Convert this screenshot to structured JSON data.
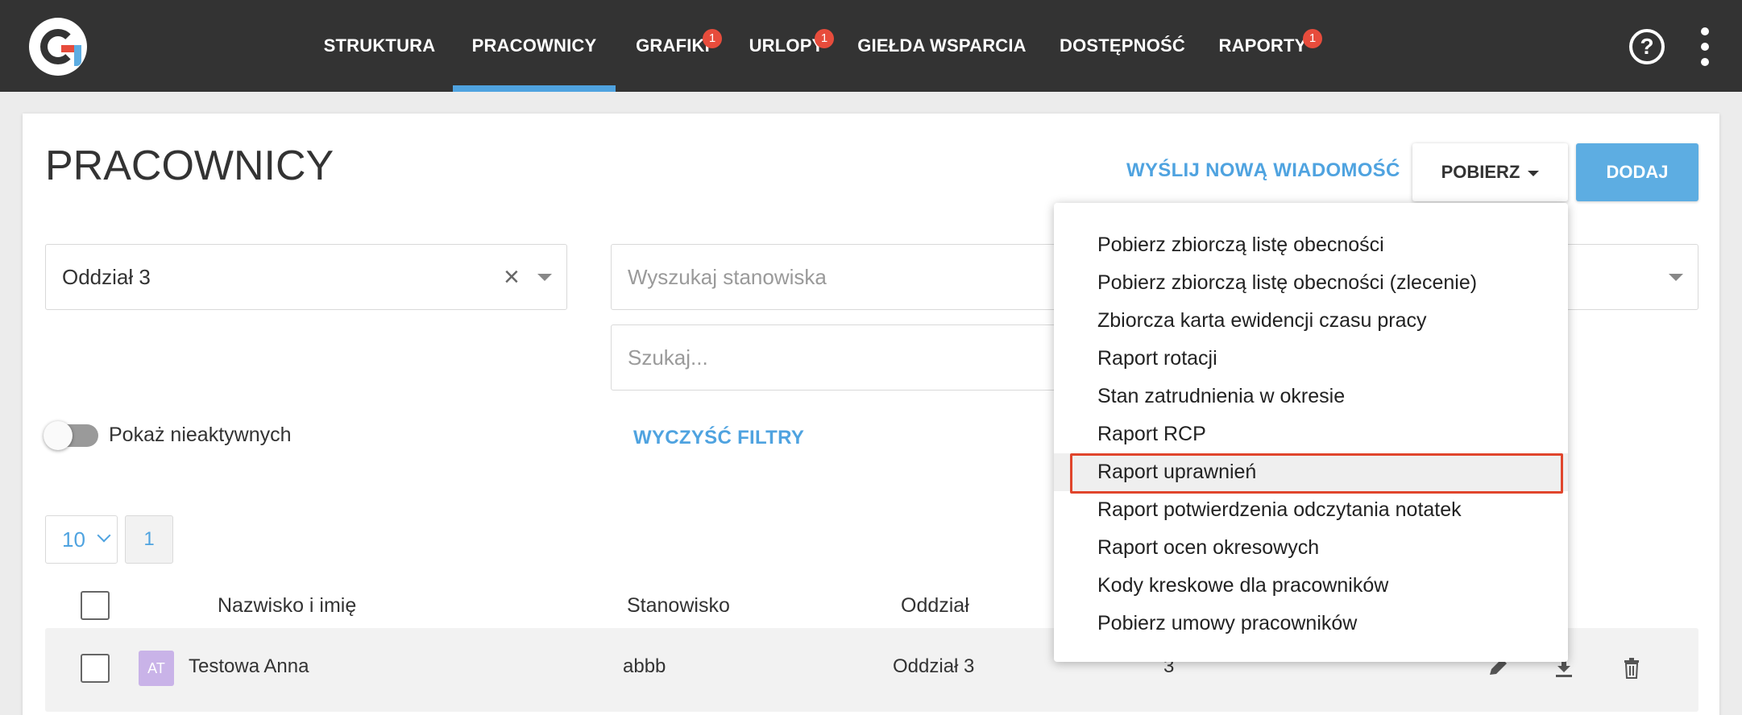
{
  "nav": {
    "items": [
      {
        "label": "STRUKTURA",
        "badge": ""
      },
      {
        "label": "PRACOWNICY",
        "badge": ""
      },
      {
        "label": "GRAFIKI",
        "badge": "1"
      },
      {
        "label": "URLOPY",
        "badge": "1"
      },
      {
        "label": "GIEŁDA WSPARCIA",
        "badge": ""
      },
      {
        "label": "DOSTĘPNOŚĆ",
        "badge": ""
      },
      {
        "label": "RAPORTY",
        "badge": "1"
      }
    ],
    "active_index": 1,
    "help_glyph": "?",
    "accent_color": "#4fa3e0"
  },
  "page": {
    "title": "PRACOWNICY",
    "send_message_label": "WYŚLIJ NOWĄ WIADOMOŚĆ",
    "download_label": "POBIERZ",
    "add_label": "DODAJ"
  },
  "filters": {
    "department_value": "Oddział 3",
    "clear_glyph": "×",
    "position_placeholder": "Wyszukaj stanowiska",
    "search_placeholder": "Szukaj...",
    "show_inactive_label": "Pokaż nieaktywnych",
    "show_inactive_on": false,
    "clear_filters_label": "WYCZYŚĆ FILTRY"
  },
  "pagination": {
    "page_size": "10",
    "current_page": "1"
  },
  "table": {
    "headers": {
      "name": "Nazwisko i imię",
      "position": "Stanowisko",
      "department": "Oddział"
    },
    "rows": [
      {
        "initials": "AT",
        "name": "Testowa Anna",
        "position": "abbb",
        "department": "Oddział 3",
        "extra": "3"
      }
    ]
  },
  "dropdown": {
    "items": [
      "Pobierz zbiorczą listę obecności",
      "Pobierz zbiorczą listę obecności (zlecenie)",
      "Zbiorcza karta ewidencji czasu pracy",
      "Raport rotacji",
      "Stan zatrudnienia w okresie",
      "Raport RCP",
      "Raport uprawnień",
      "Raport potwierdzenia odczytania notatek",
      "Raport ocen okresowych",
      "Kody kreskowe dla pracowników",
      "Pobierz umowy pracowników"
    ],
    "highlighted_index": 6,
    "highlight_color": "#e0452c"
  }
}
